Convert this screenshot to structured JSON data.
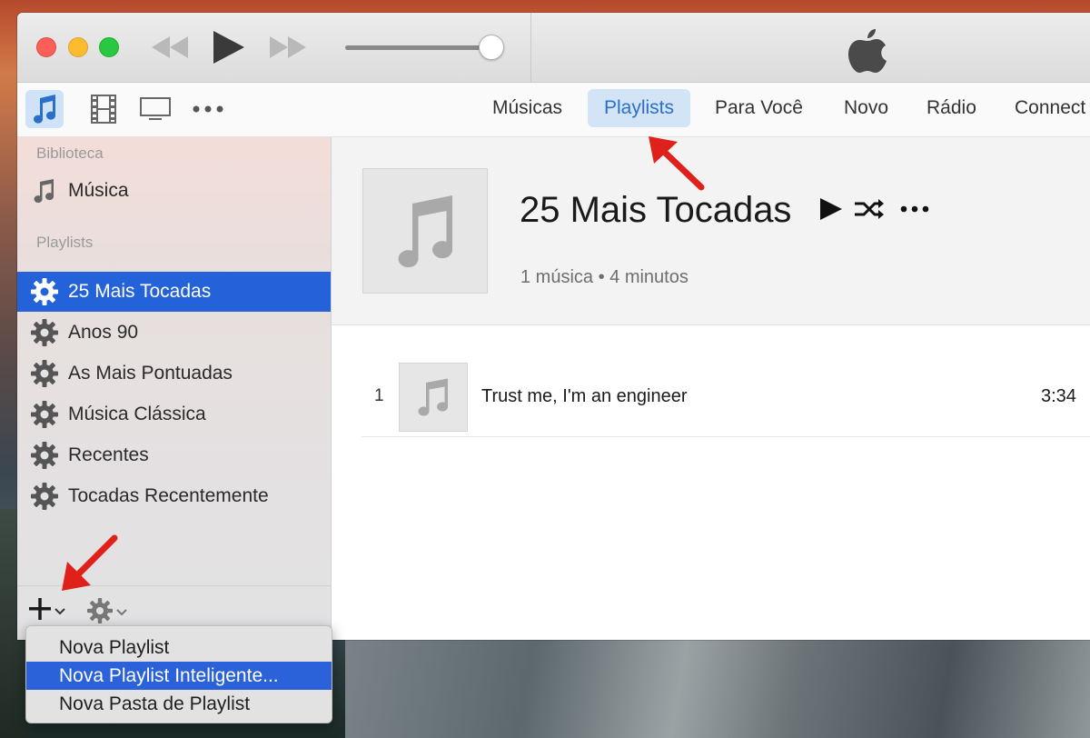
{
  "window": {
    "apple_logo": "apple-logo-icon"
  },
  "player": {
    "volume_level": 1.0
  },
  "media_types": [
    {
      "icon": "music-note-icon",
      "active": true
    },
    {
      "icon": "film-icon",
      "active": false
    },
    {
      "icon": "tv-icon",
      "active": false
    },
    {
      "icon": "more-icon",
      "active": false
    }
  ],
  "nav": {
    "tabs": [
      {
        "label": "Músicas",
        "active": false
      },
      {
        "label": "Playlists",
        "active": true
      },
      {
        "label": "Para Você",
        "active": false
      },
      {
        "label": "Novo",
        "active": false
      },
      {
        "label": "Rádio",
        "active": false
      },
      {
        "label": "Connect",
        "active": false
      }
    ]
  },
  "sidebar": {
    "library_heading": "Biblioteca",
    "library_items": [
      {
        "label": "Música",
        "icon": "music-note-icon"
      }
    ],
    "playlists_heading": "Playlists",
    "playlists": [
      {
        "label": "25 Mais Tocadas",
        "icon": "gear-icon",
        "selected": true
      },
      {
        "label": "Anos 90",
        "icon": "gear-icon",
        "selected": false
      },
      {
        "label": "As Mais Pontuadas",
        "icon": "gear-icon",
        "selected": false
      },
      {
        "label": "Música Clássica",
        "icon": "gear-icon",
        "selected": false
      },
      {
        "label": "Recentes",
        "icon": "gear-icon",
        "selected": false
      },
      {
        "label": "Tocadas Recentemente",
        "icon": "gear-icon",
        "selected": false
      }
    ]
  },
  "playlist": {
    "title": "25 Mais Tocadas",
    "meta": "1 música • 4 minutos",
    "tracks": [
      {
        "number": "1",
        "name": "Trust me, I'm an engineer",
        "duration": "3:34"
      }
    ]
  },
  "add_menu": {
    "items": [
      {
        "label": "Nova Playlist",
        "highlighted": false
      },
      {
        "label": "Nova Playlist Inteligente...",
        "highlighted": true
      },
      {
        "label": "Nova Pasta de Playlist",
        "highlighted": false
      }
    ]
  },
  "colors": {
    "accent": "#2362d8",
    "tab_active_bg": "#d4e4f7",
    "annotation_arrow": "#e0201a"
  }
}
